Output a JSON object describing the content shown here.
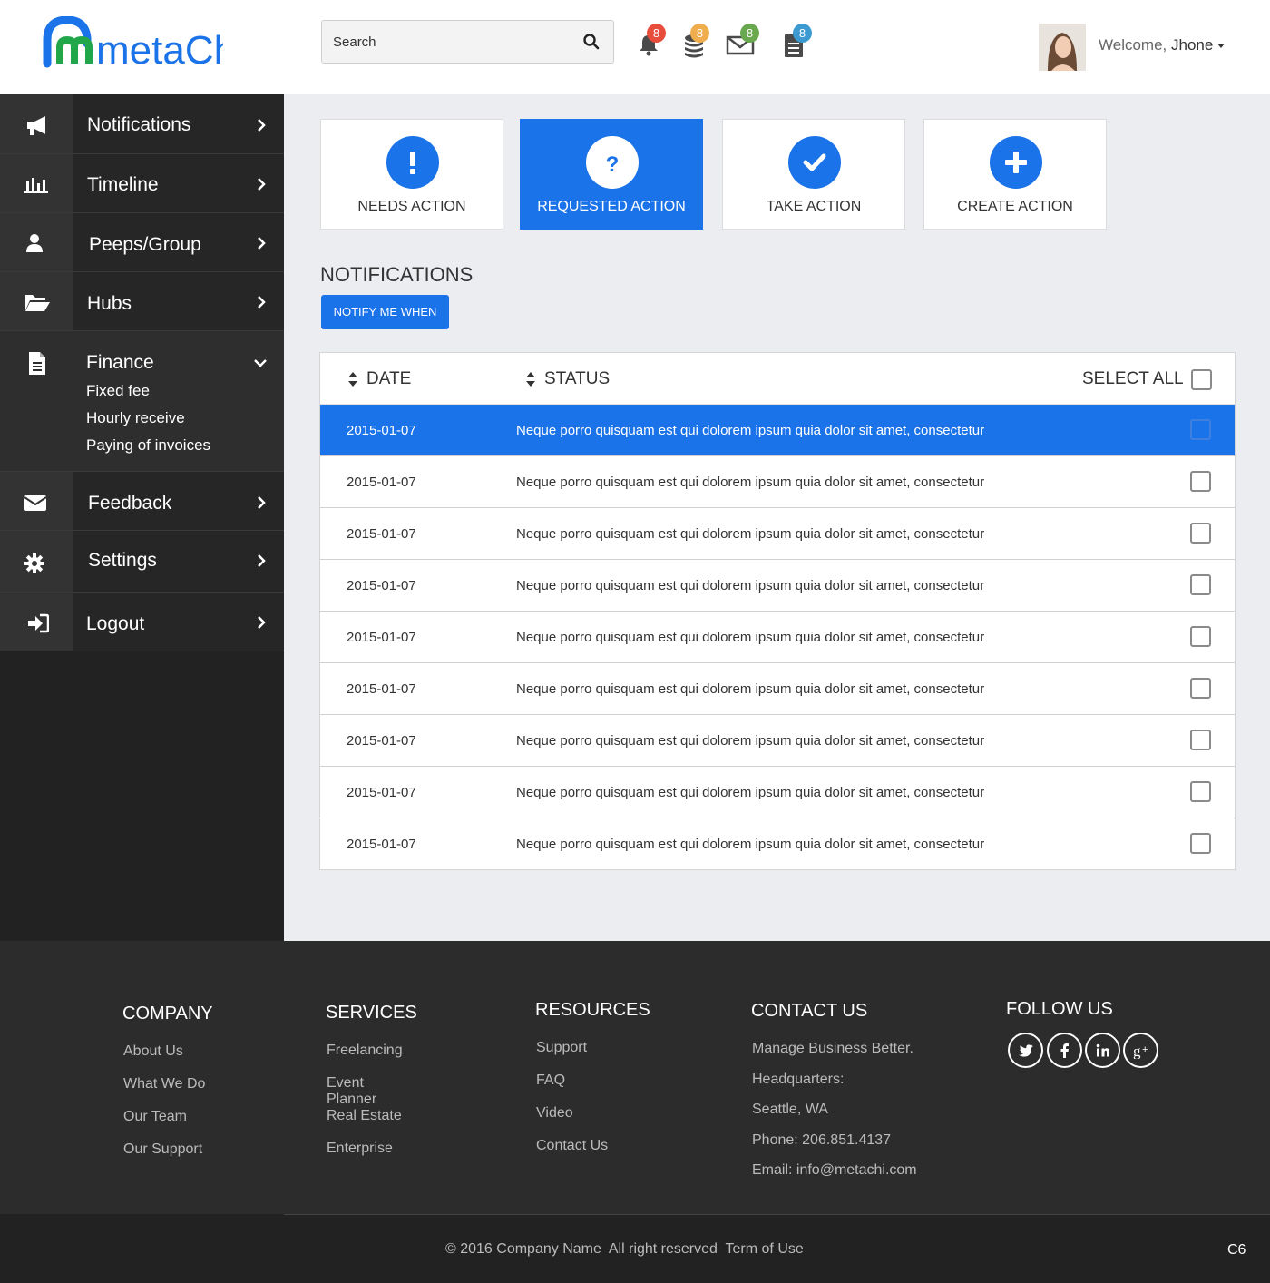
{
  "app": {
    "logo_text": "metaChi"
  },
  "header": {
    "search_placeholder": "Search",
    "badges": [
      {
        "icon": "bell-icon",
        "count": "8",
        "color": "#e84c3d"
      },
      {
        "icon": "coins-icon",
        "count": "8",
        "color": "#f0ad4e"
      },
      {
        "icon": "envelope-icon",
        "count": "8",
        "color": "#6aa84f"
      },
      {
        "icon": "document-icon",
        "count": "8",
        "color": "#3d9ad1"
      }
    ],
    "welcome_prefix": "Welcome,",
    "user_name": "Jhone"
  },
  "sidebar": {
    "items": [
      {
        "label": "Notifications",
        "icon": "megaphone-icon"
      },
      {
        "label": "Timeline",
        "icon": "bar-chart-icon"
      },
      {
        "label": "Peeps/Group",
        "icon": "user-icon"
      },
      {
        "label": "Hubs",
        "icon": "folder-open-icon"
      },
      {
        "label": "Finance",
        "icon": "file-text-icon",
        "expanded": true,
        "subitems": [
          "Fixed fee",
          "Hourly receive",
          "Paying of invoices"
        ]
      },
      {
        "label": "Feedback",
        "icon": "envelope-icon"
      },
      {
        "label": "Settings",
        "icon": "gear-icon"
      },
      {
        "label": "Logout",
        "icon": "sign-in-icon"
      }
    ]
  },
  "actions": [
    {
      "label": "NEEDS ACTION",
      "icon": "exclamation-icon",
      "active": false
    },
    {
      "label": "REQUESTED ACTION",
      "icon": "question-icon",
      "active": true
    },
    {
      "label": "TAKE ACTION",
      "icon": "check-icon",
      "active": false
    },
    {
      "label": "CREATE ACTION",
      "icon": "plus-icon",
      "active": false
    }
  ],
  "notifications": {
    "title": "NOTIFICATIONS",
    "notify_button": "NOTIFY ME WHEN",
    "columns": {
      "date": "DATE",
      "status": "STATUS",
      "select_all": "SELECT ALL"
    },
    "rows": [
      {
        "date": "2015-01-07",
        "status": "Neque porro quisquam est qui dolorem ipsum quia dolor sit amet, consectetur",
        "selected": true
      },
      {
        "date": "2015-01-07",
        "status": "Neque porro quisquam est qui dolorem ipsum quia dolor sit amet, consectetur",
        "selected": false
      },
      {
        "date": "2015-01-07",
        "status": "Neque porro quisquam est qui dolorem ipsum quia dolor sit amet, consectetur",
        "selected": false
      },
      {
        "date": "2015-01-07",
        "status": "Neque porro quisquam est qui dolorem ipsum quia dolor sit amet, consectetur",
        "selected": false
      },
      {
        "date": "2015-01-07",
        "status": "Neque porro quisquam est qui dolorem ipsum quia dolor sit amet, consectetur",
        "selected": false
      },
      {
        "date": "2015-01-07",
        "status": "Neque porro quisquam est qui dolorem ipsum quia dolor sit amet, consectetur",
        "selected": false
      },
      {
        "date": "2015-01-07",
        "status": "Neque porro quisquam est qui dolorem ipsum quia dolor sit amet, consectetur",
        "selected": false
      },
      {
        "date": "2015-01-07",
        "status": "Neque porro quisquam est qui dolorem ipsum quia dolor sit amet, consectetur",
        "selected": false
      },
      {
        "date": "2015-01-07",
        "status": "Neque porro quisquam est qui dolorem ipsum quia dolor sit amet, consectetur",
        "selected": false
      }
    ]
  },
  "footer": {
    "company": {
      "title": "COMPANY",
      "links": [
        "About Us",
        "What We Do",
        "Our Team",
        "Our Support"
      ]
    },
    "services": {
      "title": "SERVICES",
      "links": [
        "Freelancing",
        "Event Planner",
        "Real Estate",
        "Enterprise"
      ]
    },
    "resources": {
      "title": "RESOURCES",
      "links": [
        "Support",
        "FAQ",
        "Video",
        "Contact Us"
      ]
    },
    "contact": {
      "title": "CONTACT US",
      "lines": [
        "Manage Business Better.",
        "Headquarters:",
        "Seattle, WA",
        "Phone: 206.851.4137",
        "Email: info@metachi.com"
      ]
    },
    "follow": {
      "title": "FOLLOW US",
      "networks": [
        "twitter-icon",
        "facebook-icon",
        "linkedin-icon",
        "google-plus-icon"
      ]
    },
    "copyright": "© 2016 Company Name  All right reserved  Term of Use",
    "version": "C6"
  },
  "colors": {
    "accent": "#1a73e8",
    "sidebar": "#222222",
    "footer": "#2c2c2c",
    "logo_blue": "#1a73e8",
    "logo_green": "#22a64a"
  }
}
